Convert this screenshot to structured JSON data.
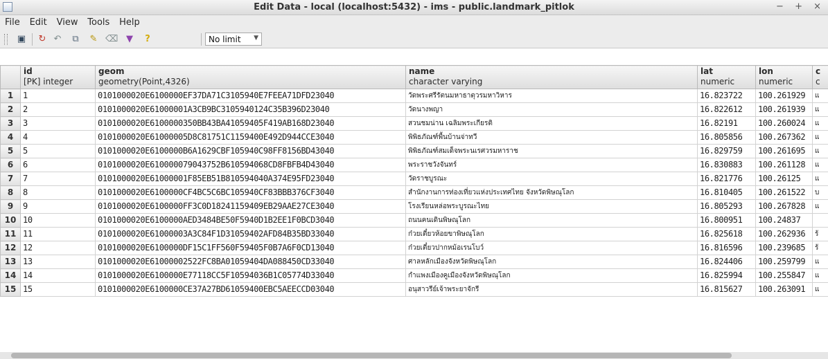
{
  "window": {
    "title": "Edit Data - local (localhost:5432) - ims - public.landmark_pitlok",
    "controls": "− + ×"
  },
  "menu": [
    "File",
    "Edit",
    "View",
    "Tools",
    "Help"
  ],
  "toolbar": {
    "limit_value": "No limit"
  },
  "columns": [
    {
      "name": "",
      "type": ""
    },
    {
      "name": "id",
      "type": "[PK] integer"
    },
    {
      "name": "geom",
      "type": "geometry(Point,4326)"
    },
    {
      "name": "name",
      "type": "character varying"
    },
    {
      "name": "lat",
      "type": "numeric"
    },
    {
      "name": "lon",
      "type": "numeric"
    },
    {
      "name": "c",
      "type": "c"
    }
  ],
  "rows": [
    {
      "n": "1",
      "id": "1",
      "geom": "0101000020E6100000EF37DA71C3105940E7FEEA71DFD23040",
      "name": "วัดพระศรีรัตนมหาธาตุวรมหาวิหาร",
      "lat": "16.823722",
      "lon": "100.261929",
      "c": "แ"
    },
    {
      "n": "2",
      "id": "2",
      "geom": "0101000020E61000001A3CB9BC3105940124C35B396D23040",
      "name": "วัดนางพญา",
      "lat": "16.822612",
      "lon": "100.261939",
      "c": "แ"
    },
    {
      "n": "3",
      "id": "3",
      "geom": "0101000020E6100000350BB43BA41059405F419AB168D23040",
      "name": "สวนชมน่าน เฉลิมพระเกียรติ",
      "lat": "16.82191",
      "lon": "100.260024",
      "c": "แ"
    },
    {
      "n": "4",
      "id": "4",
      "geom": "0101000020E61000005D8C81751C1159400E492D944CCE3040",
      "name": "พิพิธภัณฑ์พื้นบ้านจ่าทวี",
      "lat": "16.805856",
      "lon": "100.267362",
      "c": "แ"
    },
    {
      "n": "5",
      "id": "5",
      "geom": "0101000020E6100000B6A1629CBF105940C98FF8156BD43040",
      "name": "พิพิธภัณฑ์สมเด็จพระนเรศวรมหาราช",
      "lat": "16.829759",
      "lon": "100.261695",
      "c": "แ"
    },
    {
      "n": "6",
      "id": "6",
      "geom": "0101000020E610000079043752B610594068CD8FBFB4D43040",
      "name": "พระราชวังจันทร์",
      "lat": "16.830883",
      "lon": "100.261128",
      "c": "แ"
    },
    {
      "n": "7",
      "id": "7",
      "geom": "0101000020E61000001F85EB51B810594040A374E95FD23040",
      "name": "วัดราชบูรณะ",
      "lat": "16.821776",
      "lon": "100.26125",
      "c": "แ"
    },
    {
      "n": "8",
      "id": "8",
      "geom": "0101000020E6100000CF4BC5C6BC105940CF83BBB376CF3040",
      "name": "สำนักงานการท่องเที่ยวแห่งประเทศไทย จังหวัดพิษณุโลก",
      "lat": "16.810405",
      "lon": "100.261522",
      "c": "บ"
    },
    {
      "n": "9",
      "id": "9",
      "geom": "0101000020E6100000FF3C0D18241159409EB29AAE27CE3040",
      "name": "โรงเรียนหล่อพระบูรณะไทย",
      "lat": "16.805293",
      "lon": "100.267828",
      "c": "แ"
    },
    {
      "n": "10",
      "id": "10",
      "geom": "0101000020E6100000AED3484BE50F5940D1B2EE1F0BCD3040",
      "name": "ถนนคนเดินพิษณุโลก",
      "lat": "16.800951",
      "lon": "100.24837",
      "c": ""
    },
    {
      "n": "11",
      "id": "11",
      "geom": "0101000020E61000003A3C84F1D31059402AFD84B35BD33040",
      "name": "ก๋วยเตี๋ยวห้อยขาพิษณุโลก",
      "lat": "16.825618",
      "lon": "100.262936",
      "c": "ร้"
    },
    {
      "n": "12",
      "id": "12",
      "geom": "0101000020E6100000DF15C1FF560F59405F0B7A6F0CD13040",
      "name": "ก๋วยเตี๋ยวปากหม้อเรนโบว์",
      "lat": "16.816596",
      "lon": "100.239685",
      "c": "ร้"
    },
    {
      "n": "13",
      "id": "13",
      "geom": "0101000020E61000002522FC8BA01059404DA088450CD33040",
      "name": "ศาลหลักเมืองจังหวัดพิษณุโลก",
      "lat": "16.824406",
      "lon": "100.259799",
      "c": "แ"
    },
    {
      "n": "14",
      "id": "14",
      "geom": "0101000020E6100000E77118CC5F10594036B1C05774D33040",
      "name": "กำแพงเมืองคูเมืองจังหวัดพิษณุโลก",
      "lat": "16.825994",
      "lon": "100.255847",
      "c": "แ"
    },
    {
      "n": "15",
      "id": "15",
      "geom": "0101000020E6100000CE37A27BD61059400EBC5AEECCD03040",
      "name": "อนุสาวรีย์เจ้าพระยาจักรี",
      "lat": "16.815627",
      "lon": "100.263091",
      "c": "แ"
    }
  ]
}
